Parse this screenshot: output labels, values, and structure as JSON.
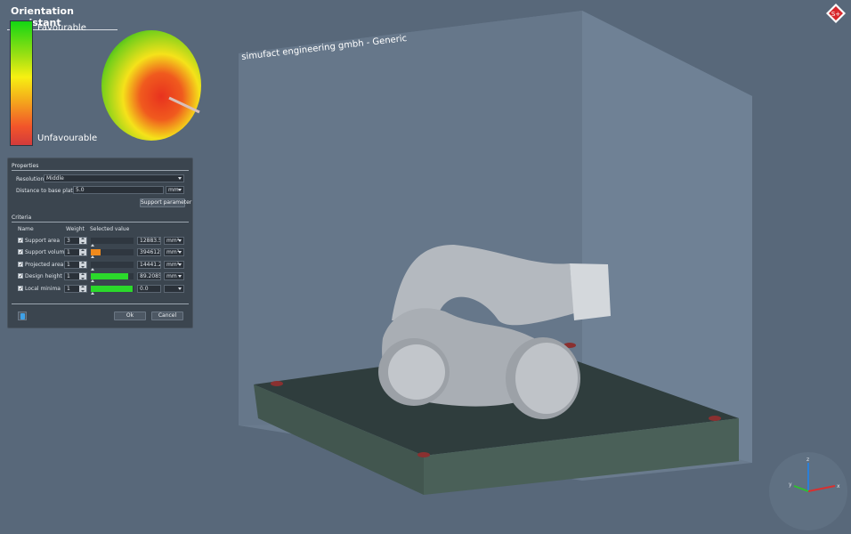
{
  "assistant": {
    "title": "Orientation assistant",
    "favourable": "Favourable",
    "unfavourable": "Unfavourable"
  },
  "scene": {
    "watermark": "simufact engineering gmbh - Generic",
    "logo_icon": "simufact-logo-icon",
    "axis": {
      "x": "x",
      "y": "y",
      "z": "z"
    }
  },
  "properties": {
    "title": "Properties",
    "resolution_label": "Resolution:",
    "resolution_value": "Middle",
    "distance_label": "Distance to base plate:",
    "distance_value": "5.0",
    "distance_unit": "mm",
    "support_parameter_button": "Support parameter"
  },
  "criteria": {
    "title": "Criteria",
    "col_name": "Name",
    "col_weight": "Weight",
    "col_selected": "Selected value",
    "rows": [
      {
        "name": "Support area",
        "checked": true,
        "weight": "3",
        "level": 0.0,
        "color": "#cfd5db",
        "value": "12883.5",
        "unit": "mm²"
      },
      {
        "name": "Support volume",
        "checked": true,
        "weight": "1",
        "level": 0.22,
        "color": "#f08a1c",
        "value": "394612.0",
        "unit": "mm³"
      },
      {
        "name": "Projected area",
        "checked": true,
        "weight": "1",
        "level": 0.0,
        "color": "#cfd5db",
        "value": "14441.2",
        "unit": "mm²"
      },
      {
        "name": "Design height",
        "checked": true,
        "weight": "1",
        "level": 0.88,
        "color": "#2bd92b",
        "value": "89.2085",
        "unit": "mm"
      },
      {
        "name": "Local minima",
        "checked": true,
        "weight": "1",
        "level": 0.98,
        "color": "#2bd92b",
        "value": "0.0",
        "unit": ""
      }
    ]
  },
  "buttons": {
    "ok": "Ok",
    "cancel": "Cancel"
  }
}
